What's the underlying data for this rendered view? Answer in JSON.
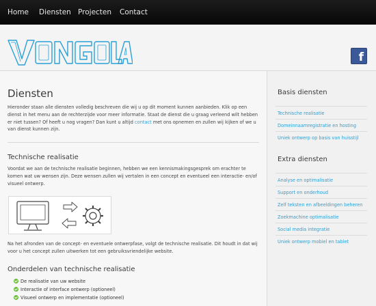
{
  "nav": [
    "Home",
    "Diensten",
    "Projecten",
    "Contact"
  ],
  "logo_text": "VONGOLA",
  "facebook_icon": "facebook-icon",
  "main": {
    "title": "Diensten",
    "intro_1": "Hieronder staan alle diensten volledig beschreven die wij u op dit moment kunnen aanbieden. Klik op een dienst in het menu aan de rechterzijde voor meer informatie. Staat de dienst die u graag verleend wilt hebben er niet tussen? Of heeft u nog vragen? Dan kunt u altijd ",
    "intro_link": "contact",
    "intro_2": " met ons opnemen en zullen wij kijken of we u van dienst kunnen zijn.",
    "section_title": "Technische realisatie",
    "section_text": "Voordat we aan de technische realisatie beginnen, hebben we een kennismakingsgesprek om erachter te komen wat uw wensen zijn. Deze wensen zullen wij vertalen in een concept en eventueel een interactie- en/of visueel ontwerp.",
    "after_text": "Na het afronden van de concept- en eventuele ontwerpfase, volgt de technische realisatie. Dit houdt in dat wij voor u het concept zullen uitwerken tot een gebruiksvriendelijke website.",
    "parts_title": "Onderdelen van technische realisatie",
    "parts": [
      "De realisatie van uw website",
      "Interactie of interface ontwerp (optioneel)",
      "Visueel ontwerp en implementatie (optioneel)"
    ]
  },
  "sidebar": {
    "basis_title": "Basis diensten",
    "basis": [
      "Technische realisatie",
      "Domeinnaamregistratie en hosting",
      "Uniek ontwerp op basis van huisstijl"
    ],
    "extra_title": "Extra diensten",
    "extra": [
      "Analyse en optimalisatie",
      "Support en onderhoud",
      "Zelf teksten en afbeeldingen beheren",
      "Zoekmachine optimalisatie",
      "Social media integratie",
      "Uniek ontwerp mobiel en tablet"
    ]
  },
  "colors": {
    "link": "#2aa0d6",
    "logo": "#2aa0d6",
    "nav_bg": "#111111",
    "check": "#6bbf3a",
    "facebook": "#3b5998"
  }
}
